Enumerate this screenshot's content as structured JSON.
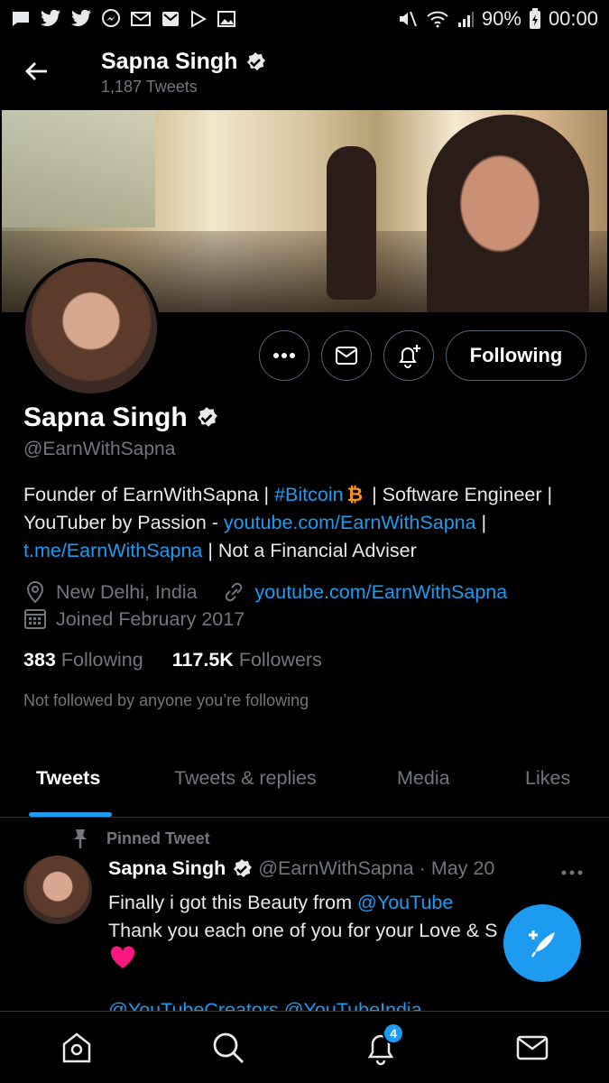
{
  "status_bar": {
    "battery": "90%",
    "time": "00:00",
    "left_icons": [
      "message-icon",
      "twitter-icon",
      "twitter-icon",
      "messenger-icon",
      "gmail-icon",
      "mail-icon",
      "play-store-icon",
      "gallery-icon"
    ]
  },
  "header": {
    "name": "Sapna Singh",
    "tweet_count": "1,187 Tweets"
  },
  "profile": {
    "name": "Sapna Singh",
    "handle": "@EarnWithSapna",
    "follow_button": "Following",
    "bio": {
      "p1": "Founder of EarnWithSapna | ",
      "hashtag": "#Bitcoin",
      "btc_symbol": "₿",
      "p2": " | Software Engineer | YouTuber by Passion - ",
      "link1": "youtube.com/EarnWithSapna",
      "p3": " | ",
      "link2": "t.me/EarnWithSapna",
      "p4": " | Not a Financial Adviser"
    },
    "location": "New Delhi, India",
    "website": "youtube.com/EarnWithSapna",
    "joined": "Joined February 2017",
    "following_count": "383",
    "following_label": "Following",
    "followers_count": "117.5K",
    "followers_label": "Followers",
    "not_followed": "Not followed by anyone you’re following"
  },
  "tabs": [
    {
      "label": "Tweets",
      "active": true
    },
    {
      "label": "Tweets & replies",
      "active": false
    },
    {
      "label": "Media",
      "active": false
    },
    {
      "label": "Likes",
      "active": false
    }
  ],
  "tweet": {
    "pinned_label": "Pinned Tweet",
    "name": "Sapna Singh",
    "handle": "@EarnWithSapna",
    "separator": "·",
    "date": "May 20",
    "line1_text": "Finally i got this Beauty from ",
    "line1_mention": "@YouTube",
    "line2": "Thank you each one of you for your Love & S",
    "emoji": "heart",
    "cut_line": "@YouTubeCreators @YouTubeIndia"
  },
  "bottom_nav": {
    "notifications_badge": "4",
    "items": [
      "home-icon",
      "search-icon",
      "notifications-icon",
      "messages-icon"
    ]
  },
  "colors": {
    "accent": "#1d9bf0",
    "muted": "#71767b",
    "bitcoin": "#f7931a",
    "heart": "#f91880"
  }
}
